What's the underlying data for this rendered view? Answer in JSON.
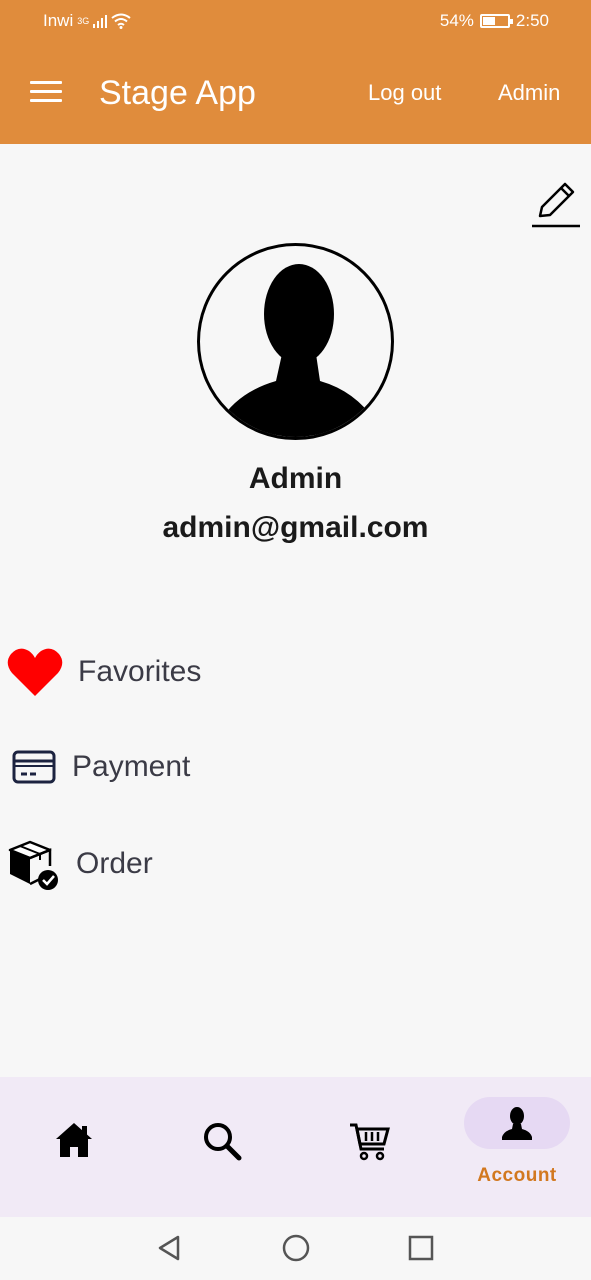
{
  "status_bar": {
    "carrier": "Inwi",
    "network": "3G",
    "battery_percent": "54%",
    "battery_level": 0.54,
    "time": "2:50"
  },
  "app_bar": {
    "title": "Stage App",
    "logout_label": "Log out",
    "admin_label": "Admin",
    "menu_icon": "hamburger-menu-icon",
    "background_color": "#e08c3c"
  },
  "profile": {
    "name": "Admin",
    "email": "admin@gmail.com",
    "edit_icon": "pencil-icon",
    "avatar_icon": "person-silhouette-icon"
  },
  "menu": {
    "items": [
      {
        "label": "Favorites",
        "icon": "heart-icon",
        "icon_color": "#ff0000"
      },
      {
        "label": "Payment",
        "icon": "credit-card-icon",
        "icon_color": "#1c2340"
      },
      {
        "label": "Order",
        "icon": "package-check-icon",
        "icon_color": "#000000"
      }
    ]
  },
  "bottom_nav": {
    "items": [
      {
        "icon": "home-icon"
      },
      {
        "icon": "search-icon"
      },
      {
        "icon": "cart-icon"
      },
      {
        "icon": "person-icon",
        "label": "Account",
        "selected": true
      }
    ],
    "accent_color": "#d2781f",
    "selected_pill_color": "#e6d9f3"
  },
  "system_nav": {
    "buttons": [
      "back-icon",
      "home-circle-icon",
      "recents-icon"
    ]
  }
}
